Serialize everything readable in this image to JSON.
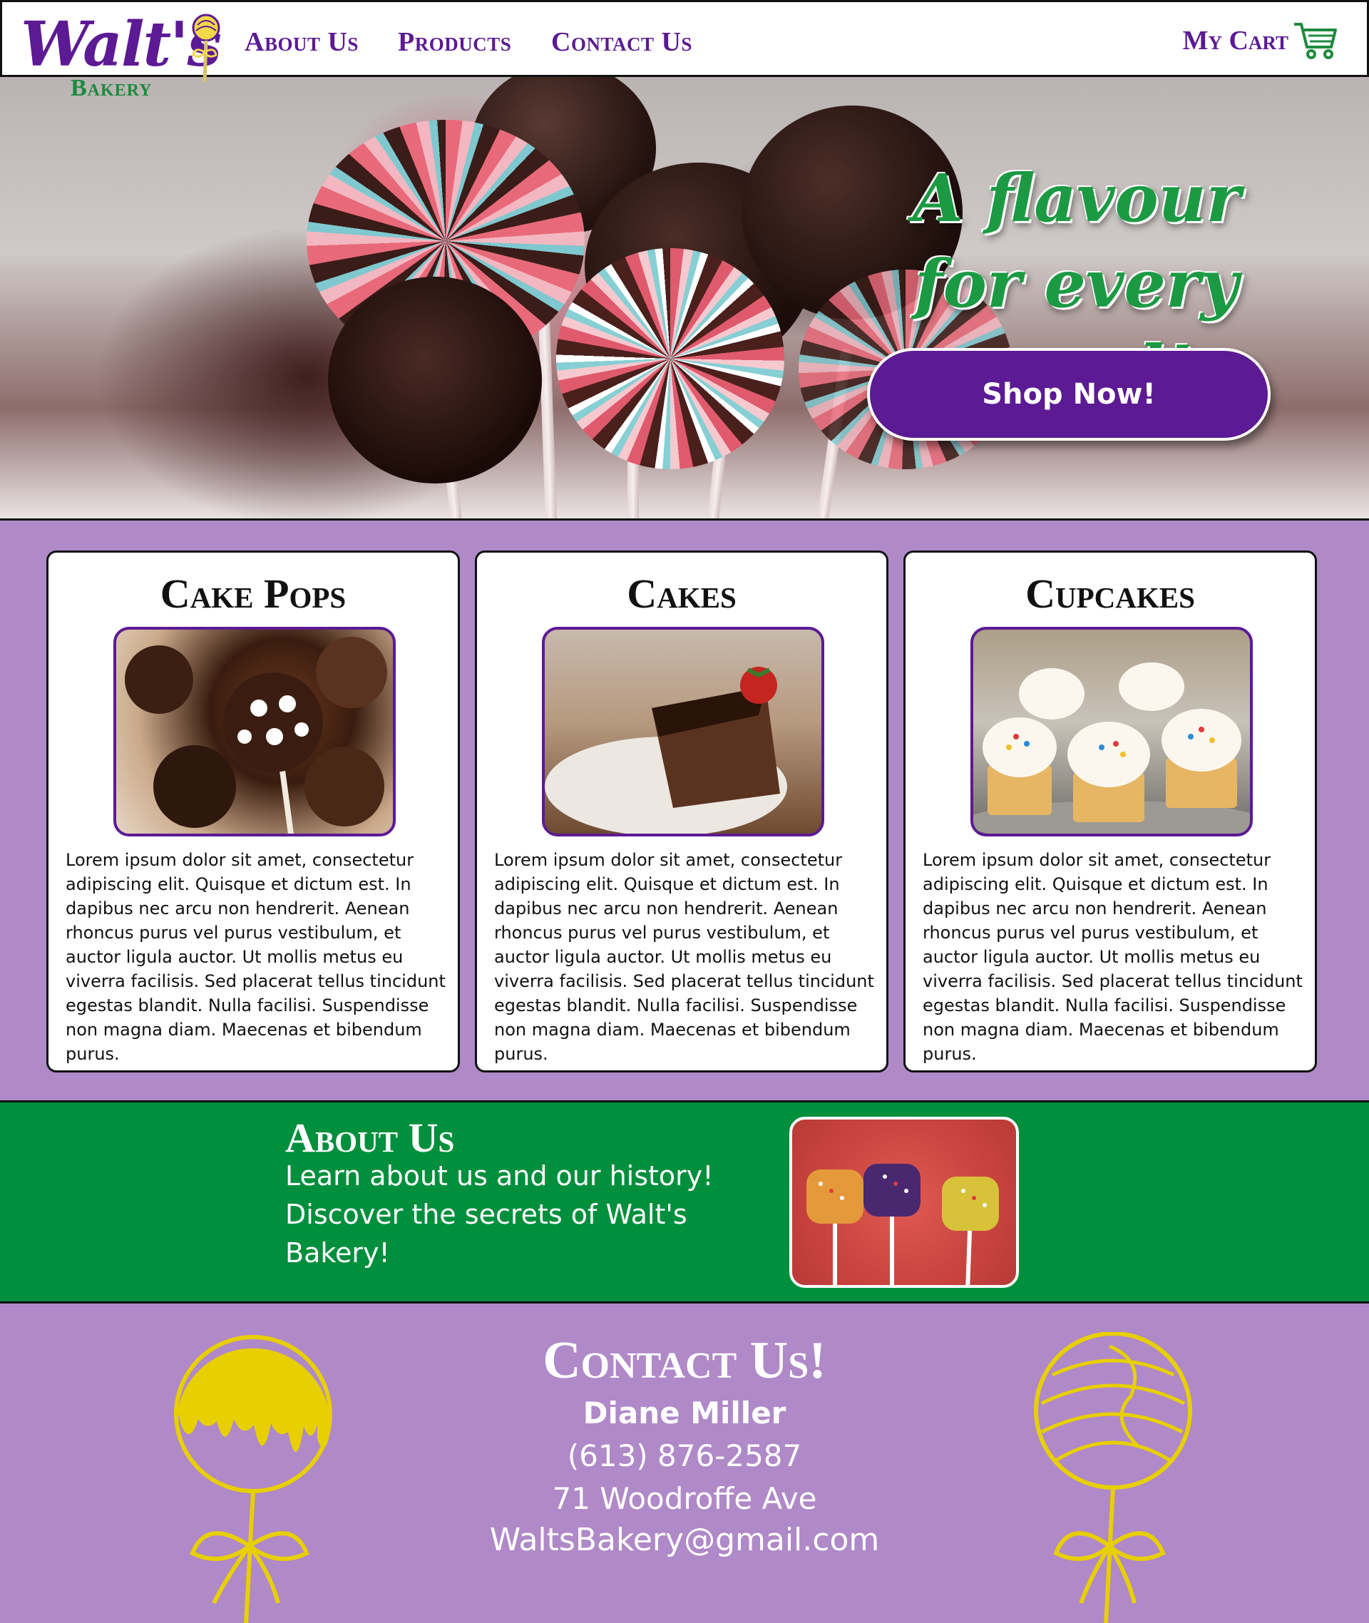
{
  "brand": {
    "name": "Walt's",
    "subtitle": "Bakery"
  },
  "nav": {
    "about": "About Us",
    "products": "Products",
    "contact": "Contact Us",
    "cart": "My Cart"
  },
  "hero": {
    "headline": "A flavour for every mood!",
    "cta": "Shop Now!"
  },
  "products": [
    {
      "title": "Cake Pops",
      "text": "Lorem ipsum dolor sit amet, consectetur adipiscing elit. Quisque et dictum est. In dapibus nec arcu non hendrerit. Aenean rhoncus purus vel purus vestibulum, et auctor ligula auctor. Ut mollis metus eu viverra facilisis. Sed placerat tellus tincidunt egestas blandit. Nulla facilisi. Suspendisse non magna diam. Maecenas et bibendum purus."
    },
    {
      "title": "Cakes",
      "text": "Lorem ipsum dolor sit amet, consectetur adipiscing elit. Quisque et dictum est. In dapibus nec arcu non hendrerit. Aenean rhoncus purus vel purus vestibulum, et auctor ligula auctor. Ut mollis metus eu viverra facilisis. Sed placerat tellus tincidunt egestas blandit. Nulla facilisi. Suspendisse non magna diam. Maecenas et bibendum purus."
    },
    {
      "title": "Cupcakes",
      "text": "Lorem ipsum dolor sit amet, consectetur adipiscing elit. Quisque et dictum est. In dapibus nec arcu non hendrerit. Aenean rhoncus purus vel purus vestibulum, et auctor ligula auctor. Ut mollis metus eu viverra facilisis. Sed placerat tellus tincidunt egestas blandit. Nulla facilisi. Suspendisse non magna diam. Maecenas et bibendum purus."
    }
  ],
  "about": {
    "title": "About Us",
    "text": "Learn about us and our history! Discover the secrets of Walt's Bakery!"
  },
  "contact": {
    "title": "Contact Us!",
    "name": "Diane Miller",
    "phone": "(613) 876-2587",
    "address": "71 Woodroffe Ave",
    "email": "WaltsBakery@gmail.com"
  },
  "colors": {
    "purple": "#5c1a94",
    "lavender": "#b089c8",
    "green": "#008f3c",
    "yellow": "#e8cf00"
  },
  "icons": {
    "cart": "shopping-cart-icon",
    "logo_pop": "lollipop-icon"
  }
}
